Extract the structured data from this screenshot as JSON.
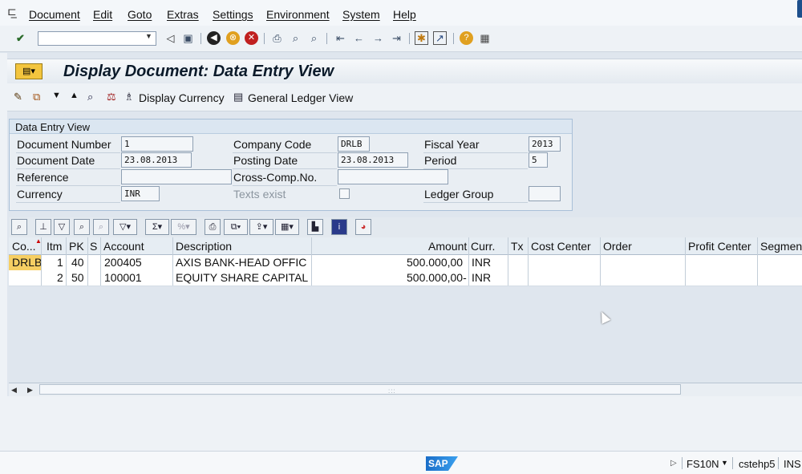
{
  "menu": {
    "items": [
      "Document",
      "Edit",
      "Goto",
      "Extras",
      "Settings",
      "Environment",
      "System",
      "Help"
    ]
  },
  "toolbar": {
    "icons": [
      "enter-icon",
      "back-icon",
      "save-icon",
      "back-nav-icon",
      "exit-icon",
      "cancel-icon",
      "print-icon",
      "find-icon",
      "find-next-icon",
      "first-page-icon",
      "prev-page-icon",
      "next-page-icon",
      "last-page-icon",
      "new-session-icon",
      "shortcut-icon",
      "help-icon",
      "layout-icon"
    ]
  },
  "title": {
    "text": "Display Document: Data Entry View"
  },
  "app_toolbar": {
    "display_currency": "Display Currency",
    "general_ledger_view": "General Ledger View"
  },
  "form": {
    "group_title": "Data Entry View",
    "document_number_label": "Document Number",
    "document_number": "1",
    "company_code_label": "Company Code",
    "company_code": "DRLB",
    "fiscal_year_label": "Fiscal Year",
    "fiscal_year": "2013",
    "document_date_label": "Document Date",
    "document_date": "23.08.2013",
    "posting_date_label": "Posting Date",
    "posting_date": "23.08.2013",
    "period_label": "Period",
    "period": "5",
    "reference_label": "Reference",
    "reference": "",
    "cross_comp_label": "Cross-Comp.No.",
    "cross_comp": "",
    "currency_label": "Currency",
    "currency": "INR",
    "texts_exist_label": "Texts exist",
    "ledger_group_label": "Ledger Group",
    "ledger_group": ""
  },
  "grid": {
    "columns": [
      "Co...",
      "Itm",
      "PK",
      "S",
      "Account",
      "Description",
      "Amount",
      "Curr.",
      "Tx",
      "Cost Center",
      "Order",
      "Profit Center",
      "Segment"
    ],
    "rows": [
      {
        "co": "DRLB",
        "itm": "1",
        "pk": "40",
        "s": "",
        "account": "200405",
        "description": "AXIS BANK-HEAD OFFIC",
        "amount": "500.000,00",
        "curr": "INR"
      },
      {
        "co": "",
        "itm": "2",
        "pk": "50",
        "s": "",
        "account": "100001",
        "description": "EQUITY SHARE CAPITAL",
        "amount": "500.000,00-",
        "curr": "INR"
      }
    ]
  },
  "status": {
    "transaction": "FS10N",
    "server": "cstehp5",
    "mode": "INS"
  },
  "colors": {
    "highlight_cell": "#f6cf63",
    "title_text": "#0b1a2a",
    "sap_logo": "#1a6ec8"
  }
}
